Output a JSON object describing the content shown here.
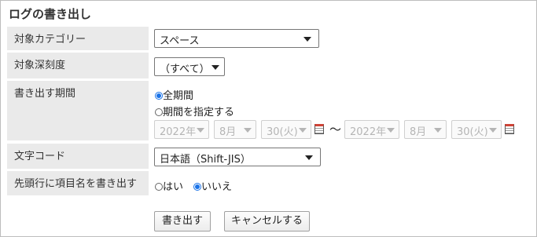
{
  "title": "ログの書き出し",
  "rows": {
    "category": {
      "label": "対象カテゴリー",
      "value": "スペース"
    },
    "depth": {
      "label": "対象深刻度",
      "value": "（すべて）"
    },
    "period": {
      "label": "書き出す期間",
      "option_all": "全期間",
      "option_range": "期間を指定する",
      "selected": "option_all",
      "from": {
        "year": "2022年",
        "month": "8月",
        "day": "30(火)"
      },
      "separator": "～",
      "to": {
        "year": "2022年",
        "month": "8月",
        "day": "30(火)"
      }
    },
    "encoding": {
      "label": "文字コード",
      "value": "日本語（Shift-JIS）"
    },
    "header_row": {
      "label": "先頭行に項目名を書き出す",
      "option_yes": "はい",
      "option_no": "いいえ",
      "selected": "option_no"
    }
  },
  "buttons": {
    "export": "書き出す",
    "cancel": "キャンセルする"
  },
  "icons": {
    "calendar": "calendar-icon",
    "dropdown": "chevron-down-icon",
    "radio": "radio-button"
  },
  "colors": {
    "label_bg": "#eaeaea",
    "radio_selected": "#1a73e8",
    "calendar_accent": "#d04437",
    "disabled_text": "#b5b5b5"
  }
}
